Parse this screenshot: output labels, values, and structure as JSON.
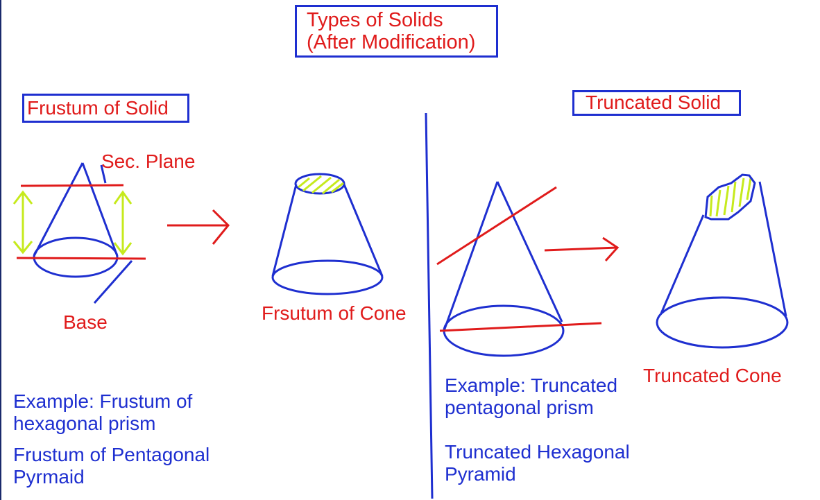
{
  "title": {
    "line1": "Types of Solids",
    "line2": "(After Modification)"
  },
  "left_section": {
    "heading": "Frustum of Solid",
    "sec_plane_label": "Sec. Plane",
    "base_label": "Base",
    "result_label": "Frsutum of Cone",
    "example1_line1": "Example: Frustum of",
    "example1_line2": "hexagonal prism",
    "example2_line1": "Frustum of Pentagonal",
    "example2_line2": "Pyrmaid"
  },
  "right_section": {
    "heading": "Truncated Solid",
    "result_label": "Truncated Cone",
    "example1_line1": "Example: Truncated",
    "example1_line2": "pentagonal prism",
    "example2_line1": "Truncated Hexagonal",
    "example2_line2": "Pyramid"
  },
  "colors": {
    "outline_blue": "#1e2fd0",
    "label_red": "#e01b1b",
    "hatch_yellow": "#c6ea1c"
  }
}
